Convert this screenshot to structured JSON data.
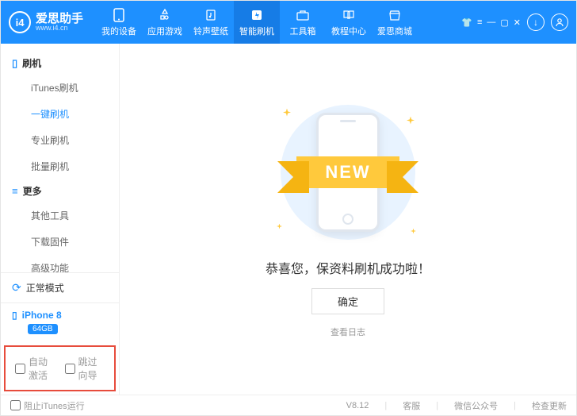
{
  "brand": {
    "name": "爱思助手",
    "url": "www.i4.cn",
    "logo_letters": "i4"
  },
  "nav": [
    {
      "label": "我的设备",
      "icon": "phone"
    },
    {
      "label": "应用游戏",
      "icon": "apps"
    },
    {
      "label": "铃声壁纸",
      "icon": "music"
    },
    {
      "label": "智能刷机",
      "icon": "flash",
      "active": true
    },
    {
      "label": "工具箱",
      "icon": "toolbox"
    },
    {
      "label": "教程中心",
      "icon": "book"
    },
    {
      "label": "爱思商城",
      "icon": "shop"
    }
  ],
  "sidebar": {
    "groups": [
      {
        "title": "刷机",
        "items": [
          {
            "label": "iTunes刷机"
          },
          {
            "label": "一键刷机",
            "active": true
          },
          {
            "label": "专业刷机"
          },
          {
            "label": "批量刷机"
          }
        ]
      },
      {
        "title": "更多",
        "items": [
          {
            "label": "其他工具"
          },
          {
            "label": "下载固件"
          },
          {
            "label": "高级功能"
          }
        ]
      }
    ],
    "status": "正常模式",
    "device": {
      "name": "iPhone 8",
      "storage": "64GB"
    },
    "checks": [
      {
        "label": "自动激活"
      },
      {
        "label": "跳过向导"
      }
    ]
  },
  "main": {
    "ribbon": "NEW",
    "message": "恭喜您，保资料刷机成功啦！",
    "ok": "确定",
    "log": "查看日志"
  },
  "footer": {
    "block_itunes": "阻止iTunes运行",
    "version": "V8.12",
    "links": [
      "客服",
      "微信公众号",
      "检查更新"
    ]
  }
}
